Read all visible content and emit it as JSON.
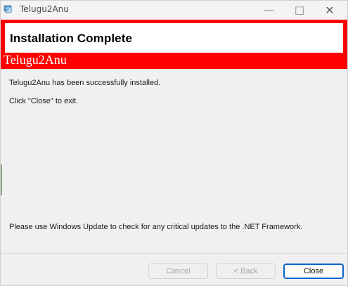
{
  "window": {
    "title": "Telugu2Anu",
    "controls": {
      "minimize_icon": "minimize-icon",
      "maximize_icon": "maximize-icon",
      "close_icon": "close-icon"
    }
  },
  "header": {
    "title": "Installation Complete",
    "brand": "Telugu2Anu"
  },
  "content": {
    "line1": "Telugu2Anu has been successfully installed.",
    "line2": "Click \"Close\" to exit.",
    "line3": "Please use Windows Update to check for any critical updates to the .NET Framework."
  },
  "buttons": {
    "cancel": "Cancel",
    "back": "< Back",
    "close": "Close"
  },
  "colors": {
    "header_red": "#ff0000",
    "accent_blue": "#0b63c9"
  }
}
